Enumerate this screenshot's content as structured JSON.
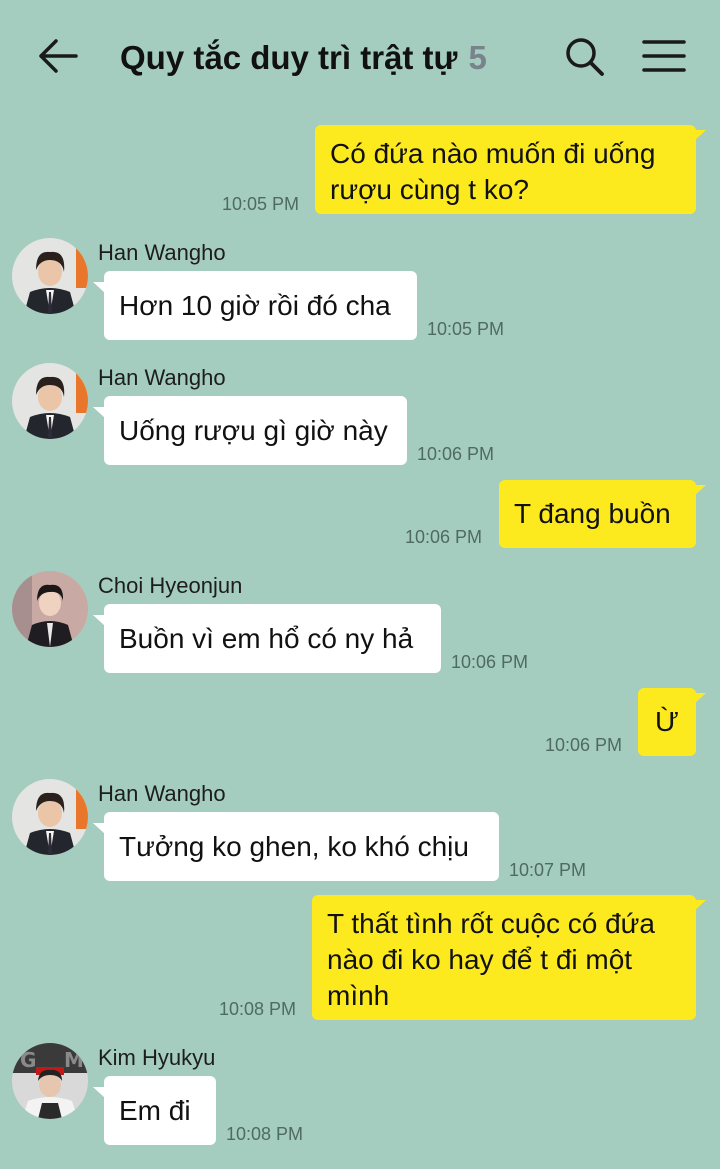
{
  "header": {
    "title": "Quy tắc duy trì trật tự",
    "member_count": "5",
    "back_icon": "arrow-left-icon",
    "search_icon": "search-icon",
    "menu_icon": "hamburger-menu-icon"
  },
  "colors": {
    "background": "#a5cdbf",
    "my_bubble": "#fdea1e",
    "their_bubble": "#ffffff"
  },
  "messages": [
    {
      "from": "me",
      "text": "Có đứa nào muốn đi uống rượu cùng t ko?",
      "time": "10:05 PM"
    },
    {
      "from": "Han Wangho",
      "text": "Hơn 10 giờ rồi đó cha",
      "time": "10:05 PM"
    },
    {
      "from": "Han Wangho",
      "text": "Uống rượu gì giờ này",
      "time": "10:06 PM"
    },
    {
      "from": "me",
      "text": "T đang buồn",
      "time": "10:06 PM"
    },
    {
      "from": "Choi Hyeonjun",
      "text": "Buồn vì em hổ có ny hả",
      "time": "10:06 PM"
    },
    {
      "from": "me",
      "text": "Ừ",
      "time": "10:06 PM"
    },
    {
      "from": "Han Wangho",
      "text": "Tưởng ko ghen, ko khó chịu",
      "time": "10:07 PM"
    },
    {
      "from": "me",
      "text": "T thất tình rốt cuộc có đứa nào đi ko hay để t đi một mình",
      "time": "10:08 PM"
    },
    {
      "from": "Kim Hyukyu",
      "text": "Em đi",
      "time": "10:08 PM"
    }
  ]
}
